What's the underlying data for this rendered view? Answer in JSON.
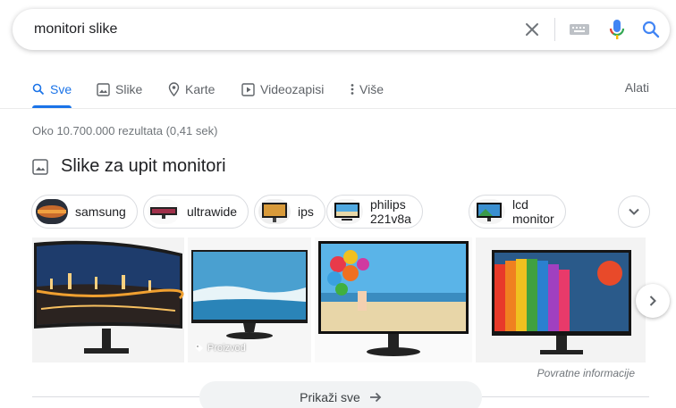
{
  "search": {
    "query": "monitori slike"
  },
  "tabs": [
    {
      "label": "Sve",
      "icon": "search-icon",
      "active": true
    },
    {
      "label": "Slike",
      "icon": "image-icon"
    },
    {
      "label": "Karte",
      "icon": "map-pin-icon"
    },
    {
      "label": "Videozapisi",
      "icon": "play-icon"
    },
    {
      "label": "Više",
      "icon": "more-vert-icon"
    }
  ],
  "tools_label": "Alati",
  "result_stats": "Oko 10.700.000 rezultata (0,41 sek)",
  "images_section": {
    "title": "Slike za upit monitori",
    "chips": [
      "samsung",
      "ultrawide",
      "ips",
      "philips 221v8a",
      "lcd monitor"
    ],
    "product_badge": "Proizvod",
    "feedback": "Povratne informacije",
    "show_all": "Prikaži sve"
  },
  "colors": {
    "accent": "#1a73e8",
    "mic_red": "#ea4335",
    "mic_yellow": "#fbbc05",
    "mic_green": "#34a853"
  }
}
